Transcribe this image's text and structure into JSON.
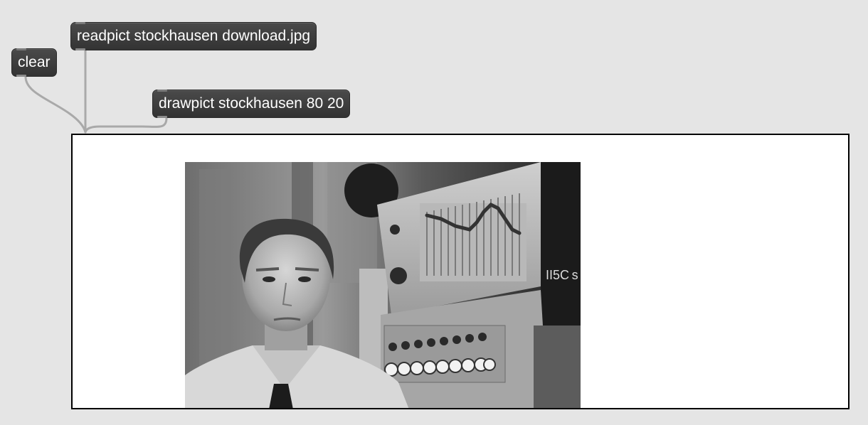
{
  "patch": {
    "messages": {
      "readpict": "readpict stockhausen download.jpg",
      "clear": "clear",
      "drawpict": "drawpict stockhausen 80 20"
    },
    "display": {
      "object": "lcd",
      "image_description_icon": "stockhausen-photo",
      "overlay_text": "II5C s"
    }
  },
  "colors": {
    "background": "#e5e5e5",
    "message_box": "#3b3b3b",
    "message_text": "#ffffff",
    "patch_cord": "#a8a8a8",
    "lcd_border": "#000000",
    "lcd_background": "#ffffff"
  }
}
